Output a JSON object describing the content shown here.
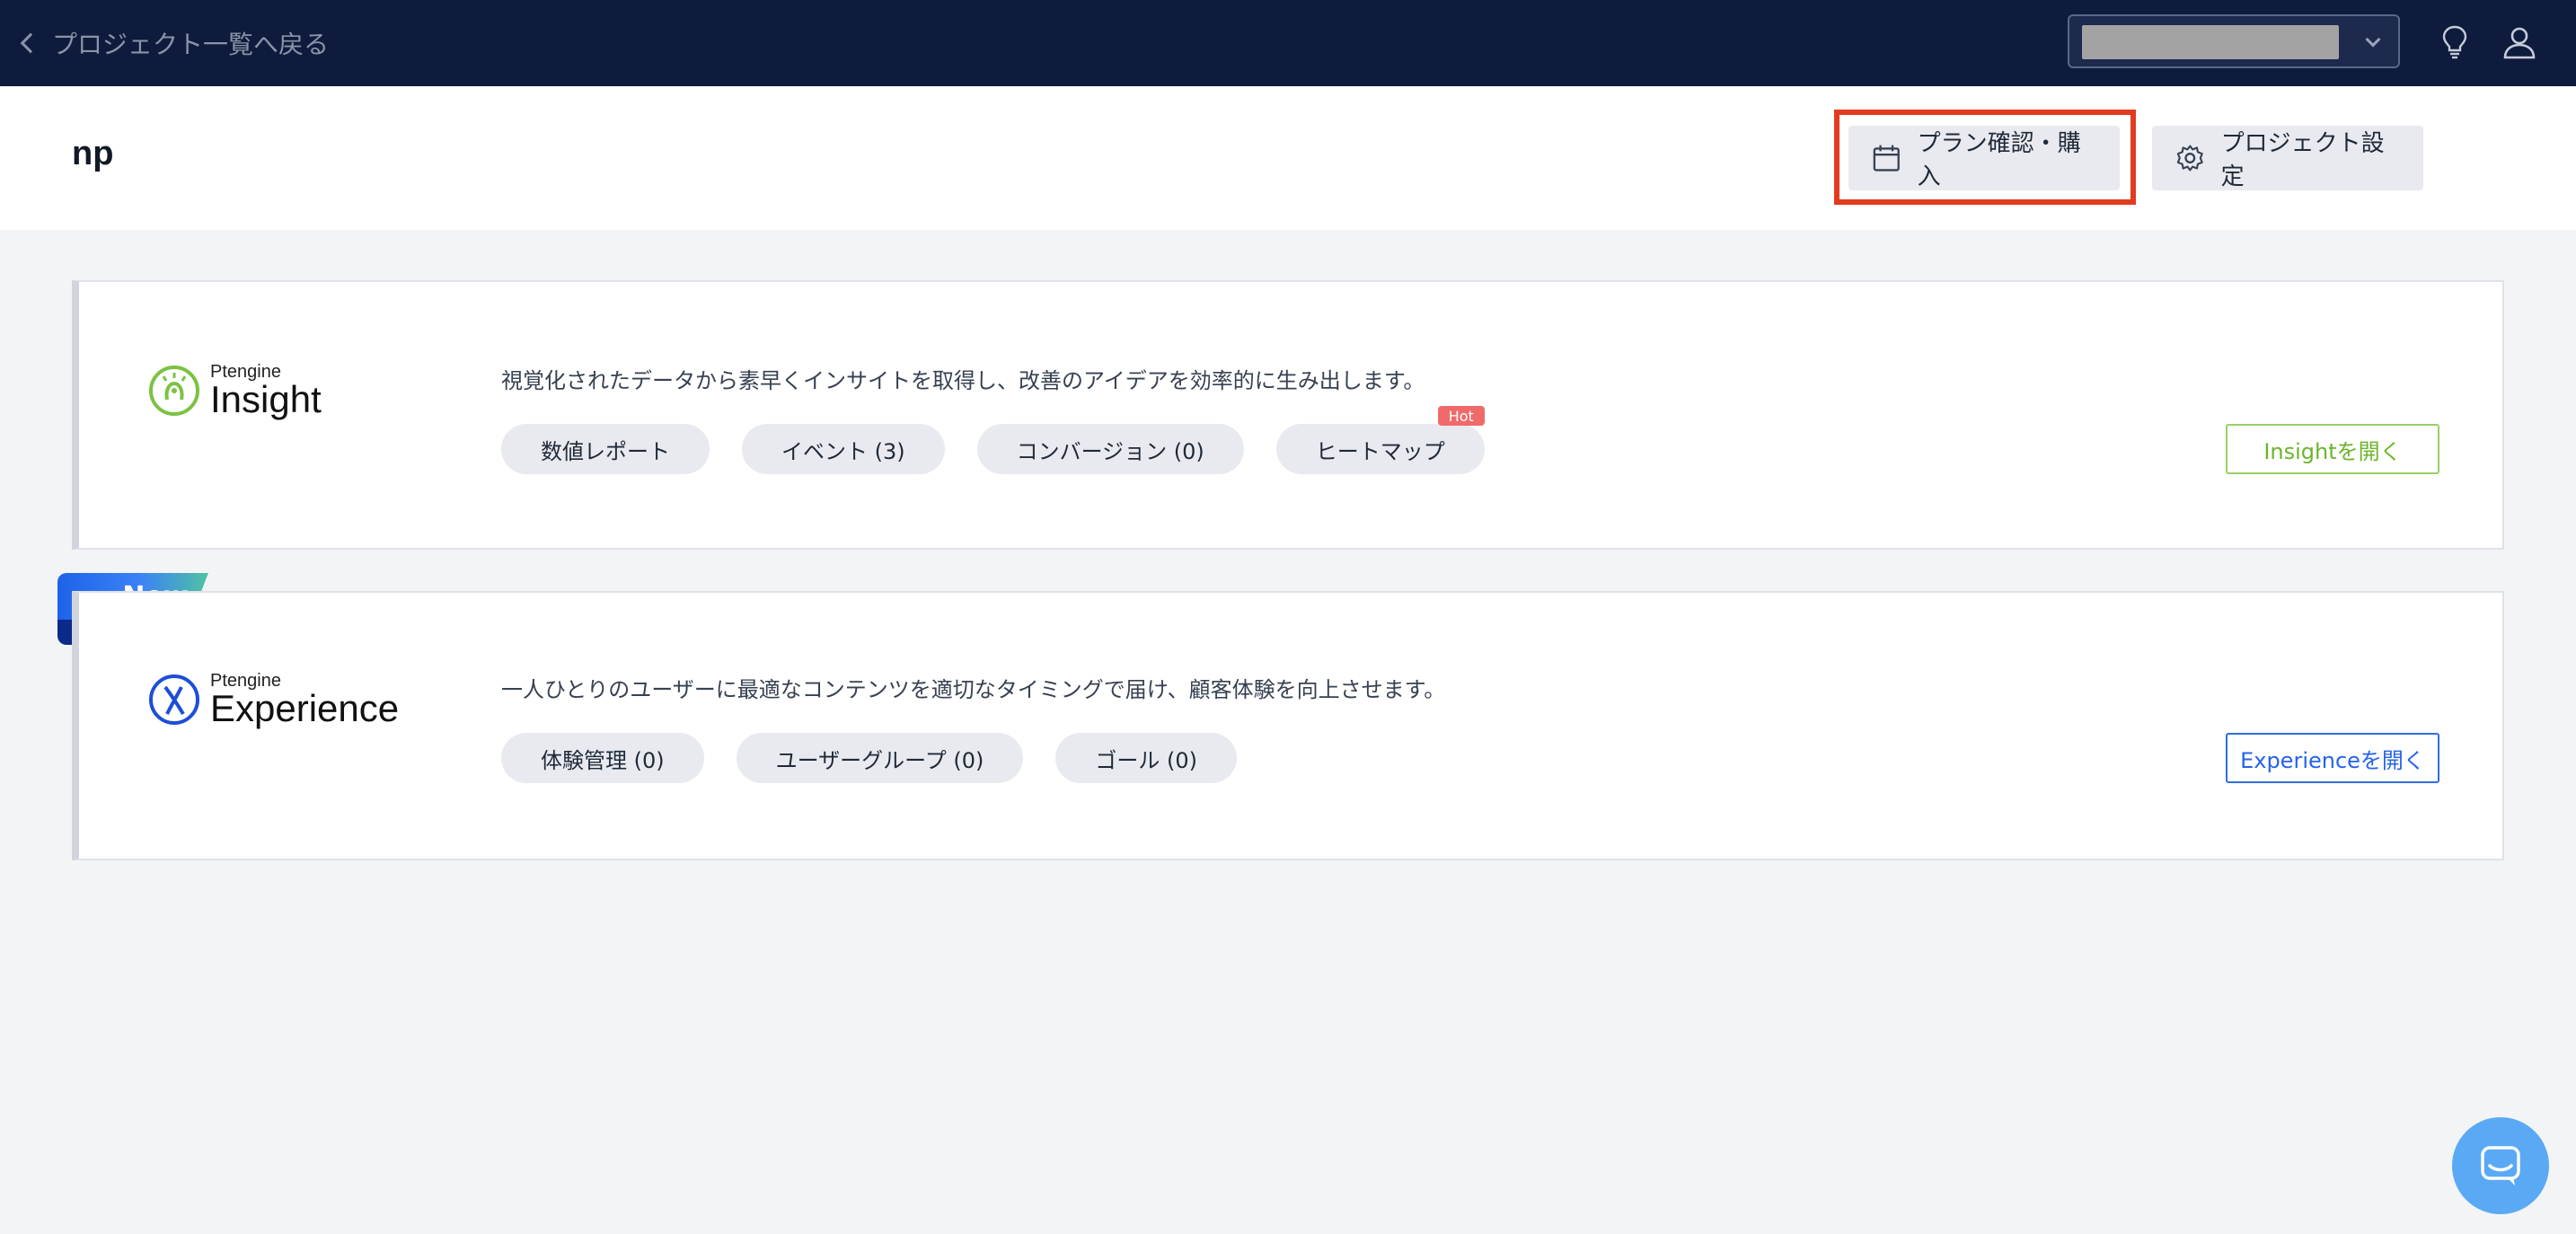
{
  "topbar": {
    "back_label": "プロジェクト一覧へ戻る"
  },
  "header": {
    "project_name": "np",
    "plan_button": "プラン確認・購入",
    "settings_button": "プロジェクト設定"
  },
  "insight": {
    "logo_small": "Ptengine",
    "logo_big": "Insight",
    "description": "視覚化されたデータから素早くインサイトを取得し、改善のアイデアを効率的に生み出します。",
    "pills": [
      "数値レポート",
      "イベント (3)",
      "コンバージョン (0)",
      "ヒートマップ"
    ],
    "hot_badge": "Hot",
    "open_button": "Insightを開く",
    "accent": "#6cb52b"
  },
  "experience": {
    "ribbon": "New",
    "logo_small": "Ptengine",
    "logo_big": "Experience",
    "description": "一人ひとりのユーザーに最適なコンテンツを適切なタイミングで届け、顧客体験を向上させます。",
    "pills": [
      "体験管理 (0)",
      "ユーザーグループ (0)",
      "ゴール (0)"
    ],
    "open_button": "Experienceを開く",
    "accent": "#2563eb"
  },
  "icons": {
    "back": "chevron-left-icon",
    "bulb": "lightbulb-icon",
    "user": "user-icon",
    "calendar": "calendar-icon",
    "gear": "gear-icon",
    "chat": "chat-icon"
  }
}
